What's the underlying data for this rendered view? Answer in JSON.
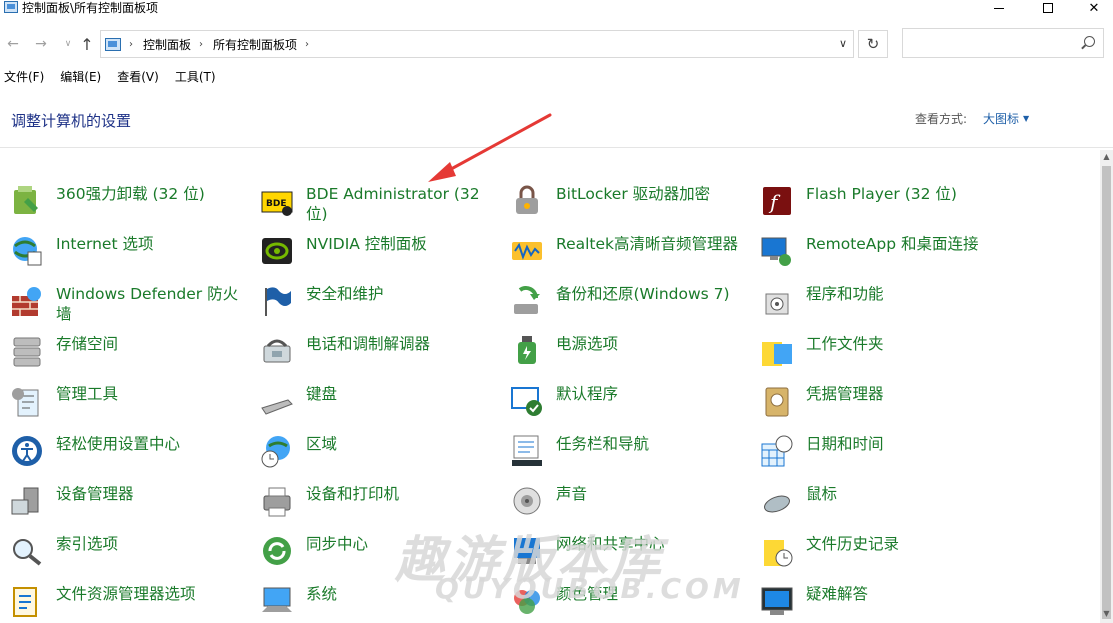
{
  "window": {
    "title": "控制面板\\所有控制面板项"
  },
  "address": {
    "crumbs": [
      "控制面板",
      "所有控制面板项"
    ]
  },
  "search": {
    "placeholder": ""
  },
  "menu": {
    "items": [
      "文件(F)",
      "编辑(E)",
      "查看(V)",
      "工具(T)"
    ]
  },
  "header": {
    "heading": "调整计算机的设置",
    "view_by_label": "查看方式:",
    "view_by_value": "大图标"
  },
  "colors": {
    "item_text": "#1a7a2a",
    "heading": "#1e3287",
    "link": "#1e5fa8",
    "arrow": "#e53935"
  },
  "items": [
    [
      "360强力卸载 (32 位)",
      "BDE Administrator (32 位)",
      "BitLocker 驱动器加密",
      "Flash Player (32 位)"
    ],
    [
      "Internet 选项",
      "NVIDIA 控制面板",
      "Realtek高清晰音频管理器",
      "RemoteApp 和桌面连接"
    ],
    [
      "Windows Defender 防火墙",
      "安全和维护",
      "备份和还原(Windows 7)",
      "程序和功能"
    ],
    [
      "存储空间",
      "电话和调制解调器",
      "电源选项",
      "工作文件夹"
    ],
    [
      "管理工具",
      "键盘",
      "默认程序",
      "凭据管理器"
    ],
    [
      "轻松使用设置中心",
      "区域",
      "任务栏和导航",
      "日期和时间"
    ],
    [
      "设备管理器",
      "设备和打印机",
      "声音",
      "鼠标"
    ],
    [
      "索引选项",
      "同步中心",
      "网络和共享中心",
      "文件历史记录"
    ],
    [
      "文件资源管理器选项",
      "系统",
      "颜色管理",
      "疑难解答"
    ]
  ],
  "icons": [
    [
      "uninstall-icon",
      "bde-icon",
      "bitlocker-icon",
      "flash-icon"
    ],
    [
      "internet-options-icon",
      "nvidia-icon",
      "realtek-audio-icon",
      "remoteapp-icon"
    ],
    [
      "firewall-icon",
      "security-flag-icon",
      "backup-icon",
      "programs-icon"
    ],
    [
      "storage-icon",
      "phone-modem-icon",
      "power-icon",
      "work-folders-icon"
    ],
    [
      "admin-tools-icon",
      "keyboard-icon",
      "default-programs-icon",
      "credential-icon"
    ],
    [
      "ease-of-access-icon",
      "region-icon",
      "taskbar-icon",
      "datetime-icon"
    ],
    [
      "device-manager-icon",
      "printer-icon",
      "sound-icon",
      "mouse-icon"
    ],
    [
      "indexing-icon",
      "sync-icon",
      "network-icon",
      "file-history-icon"
    ],
    [
      "explorer-options-icon",
      "system-icon",
      "color-management-icon",
      "troubleshoot-icon"
    ]
  ],
  "watermark": {
    "main": "趣游版本库",
    "sub": "QUYOUBOB.COM"
  }
}
